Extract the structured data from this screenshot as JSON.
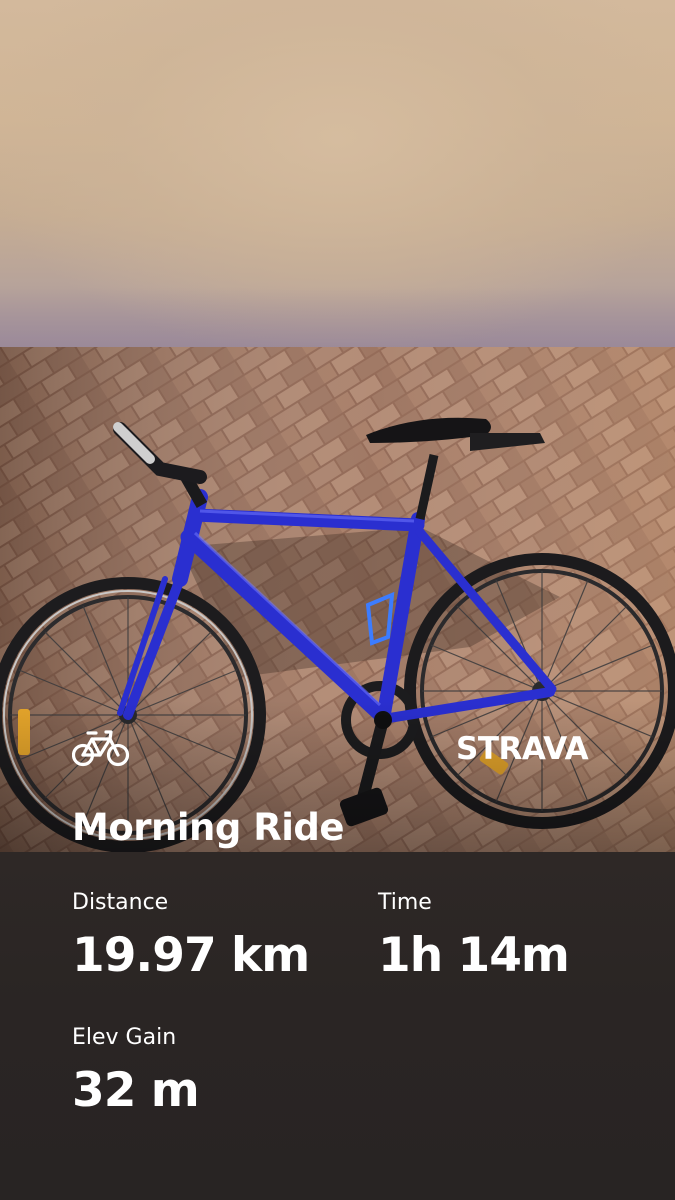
{
  "activity": {
    "title": "Morning Ride",
    "brand": "STRAVA",
    "icon": "bicycle-icon"
  },
  "stats": [
    {
      "label": "Distance",
      "value": "19.97 km"
    },
    {
      "label": "Time",
      "value": "1h 14m"
    },
    {
      "label": "Elev Gain",
      "value": "32 m"
    }
  ],
  "colors": {
    "bike_frame": "#2a2fd0",
    "brick": "#9a6e58",
    "panel": "#2b2624",
    "text": "#ffffff"
  }
}
